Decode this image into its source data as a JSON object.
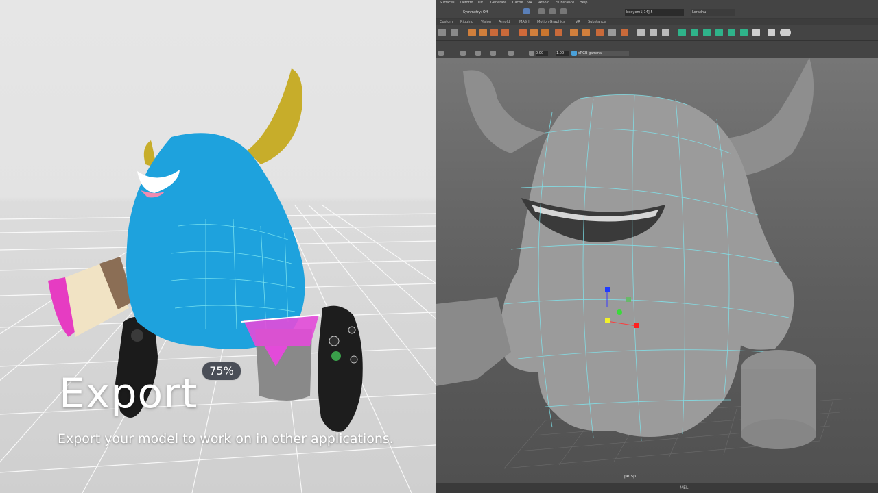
{
  "vr": {
    "title": "Export",
    "subtitle": "Export your model to work on in other applications.",
    "progress_label": "75%"
  },
  "maya": {
    "menu": [
      "Surfaces",
      "Deform",
      "UV",
      "Generate",
      "Cache",
      "VR",
      "Arnold",
      "Substance",
      "Help"
    ],
    "symmetry": "Symmetry: Off",
    "selection_field": "bodyem1[14]:5",
    "user": "Loradhu",
    "shelf_tabs": [
      "Custom",
      "Rigging",
      "Vision",
      "Arnold",
      "MASH",
      "Motion Graphics",
      "VR",
      "Substance"
    ],
    "exposure": "0.00",
    "gamma": "1.00",
    "color_space": "sRGB gamma",
    "camera_label": "persp",
    "mel_label": "MEL"
  },
  "colors": {
    "monster_blue": "#1ea2dd",
    "horn_yellow": "#cdb22c",
    "brush_pink": "#e43bc0",
    "wire_cyan": "#7fe7f0",
    "maya_bg": "#444444"
  }
}
